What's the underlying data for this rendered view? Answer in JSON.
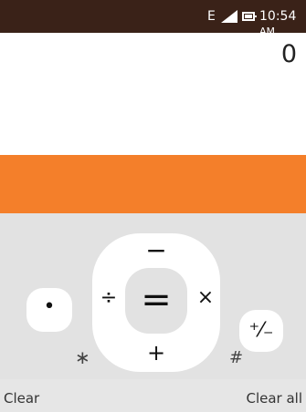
{
  "status_bar": {
    "network": "E",
    "time": "10:54",
    "ampm": "AM",
    "icons": [
      "signal-icon",
      "battery-icon"
    ]
  },
  "display": {
    "value": "0"
  },
  "keypad": {
    "minus": "−",
    "plus": "+",
    "divide": "÷",
    "multiply": "×",
    "equals": "=",
    "dot": "•",
    "sign": "⁺⁄₋",
    "star": "∗",
    "hash": "#"
  },
  "softkeys": {
    "left": "Clear",
    "right": "Clear all"
  },
  "colors": {
    "status_bar": "#3a2218",
    "accent": "#f47f2a",
    "keypad_bg": "#e2e2e2"
  }
}
